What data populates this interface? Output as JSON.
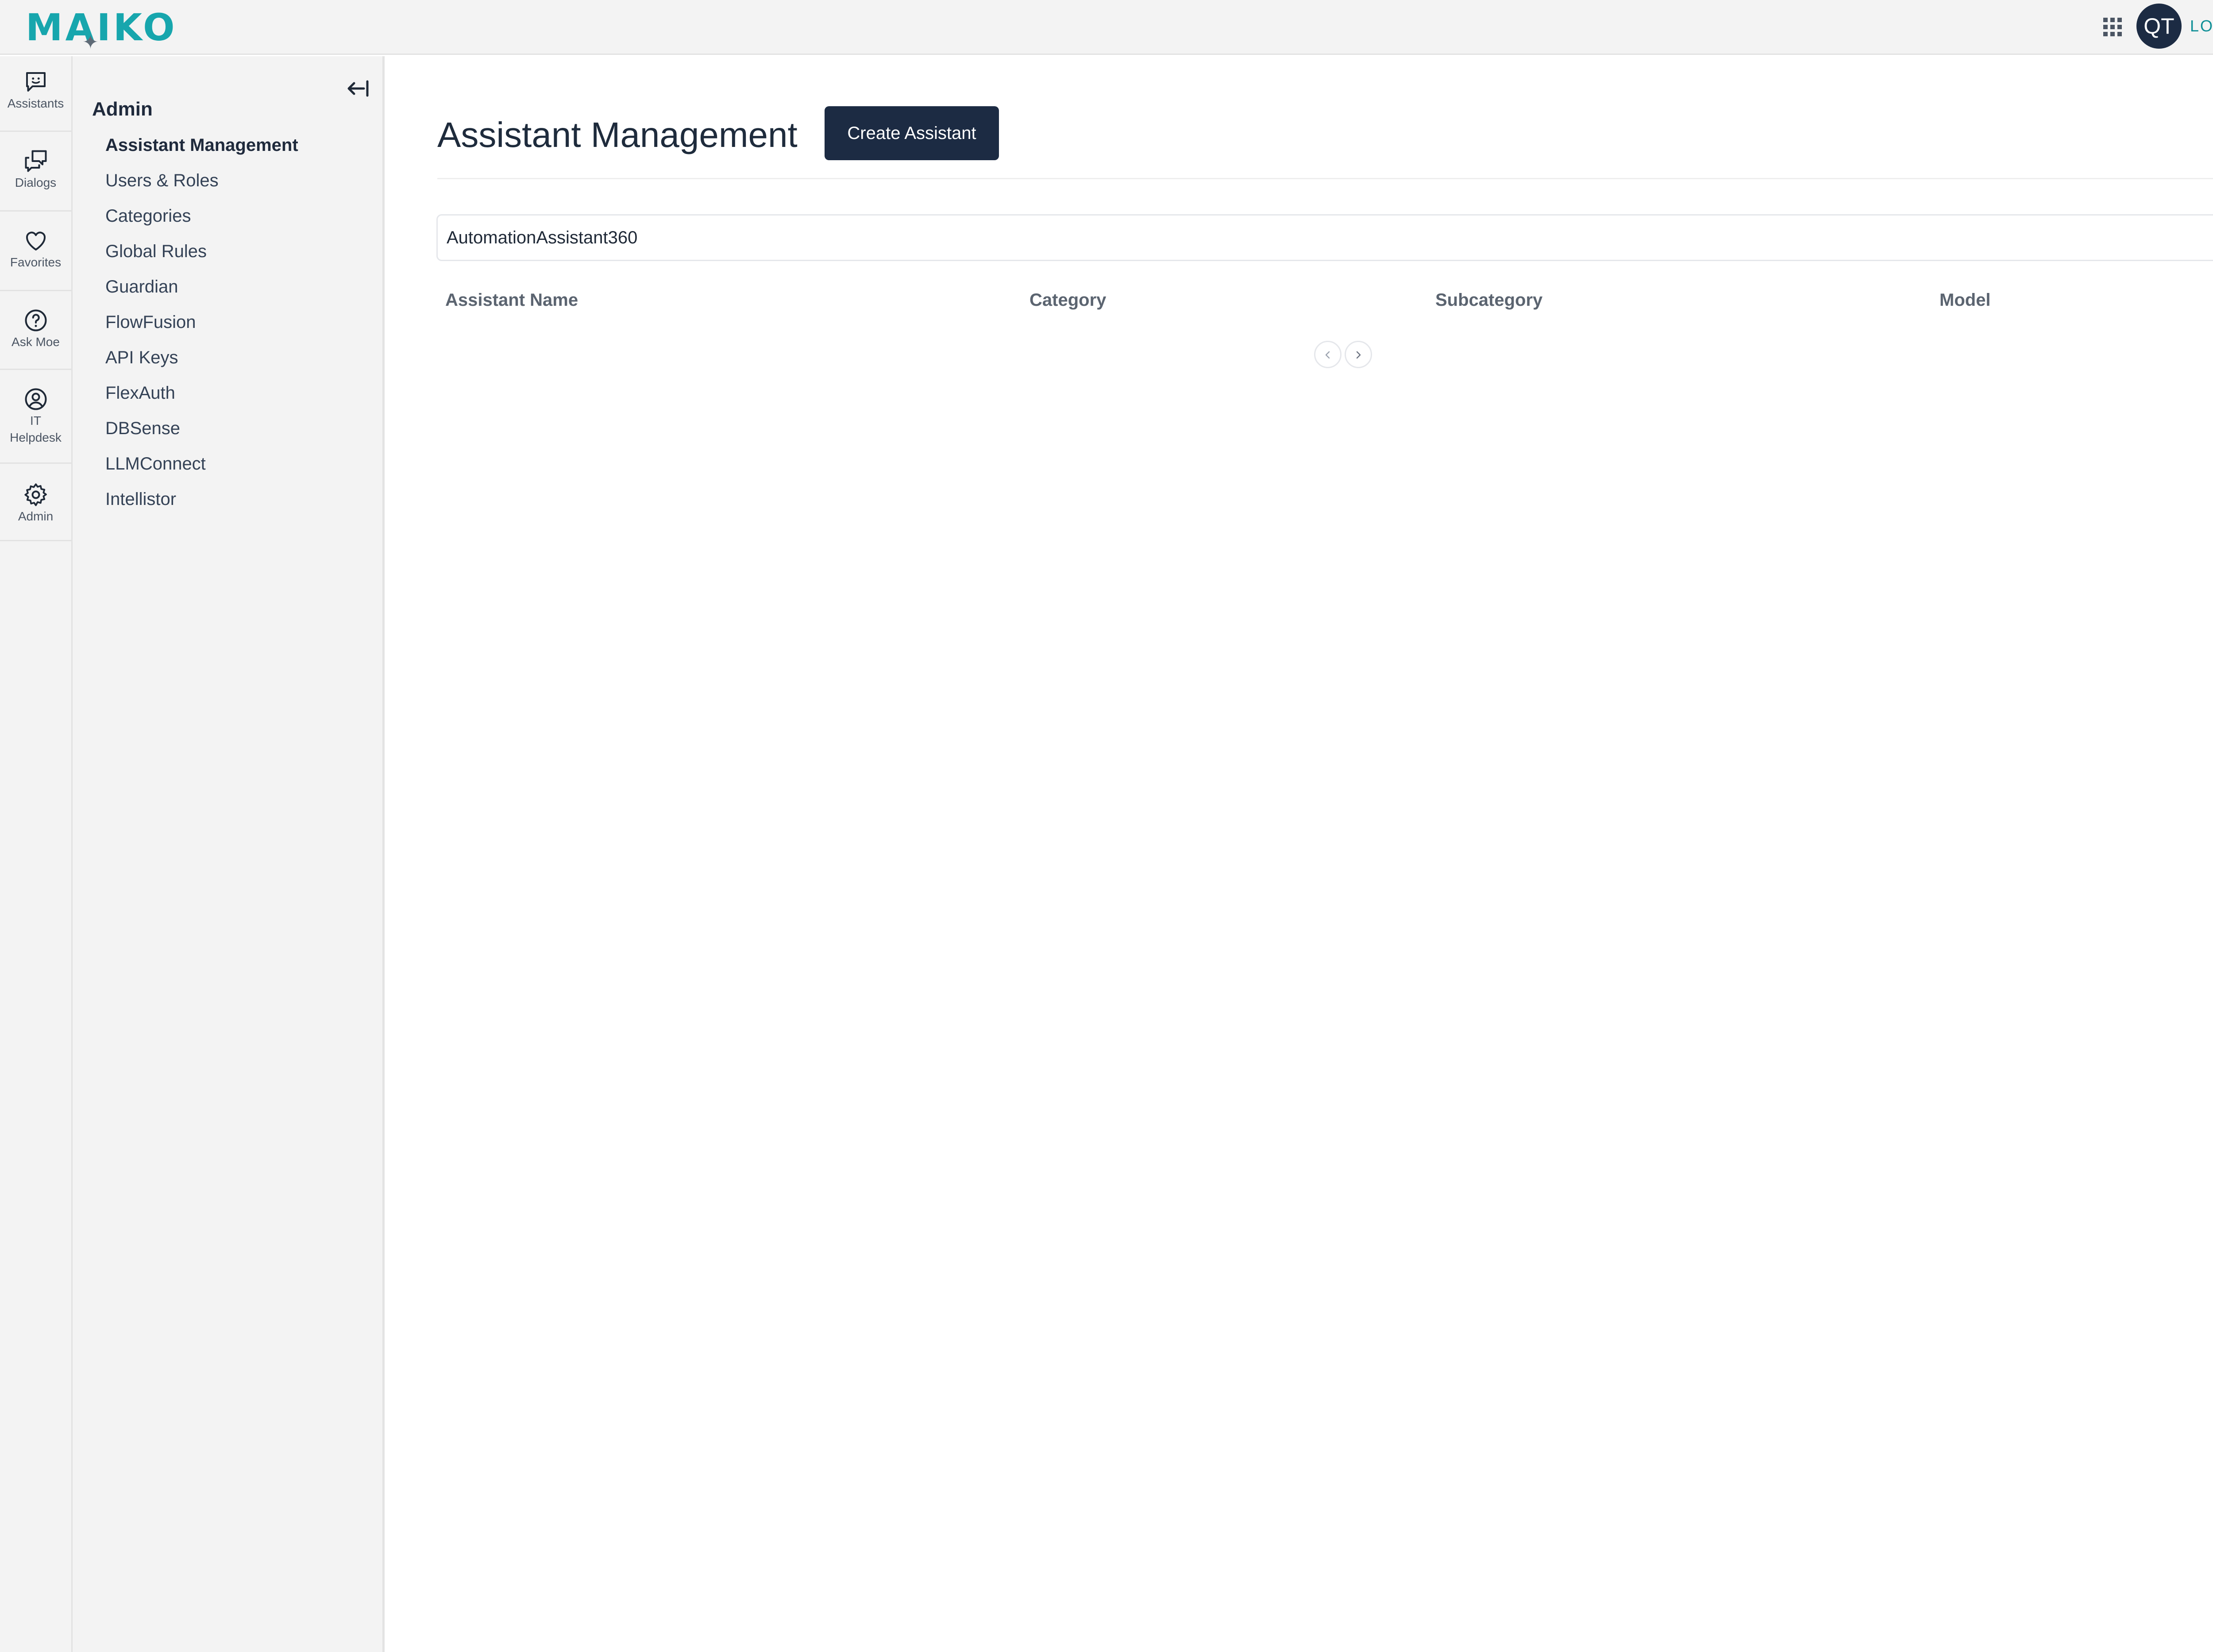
{
  "header": {
    "logo_text": "MAIKO",
    "avatar_initials": "QT",
    "logout_label": "LOGOUT",
    "apps_icon": "grid-icon"
  },
  "rail": {
    "items": [
      {
        "label": "Assistants",
        "icon": "chat-bot-icon"
      },
      {
        "label": "Dialogs",
        "icon": "dialogs-icon"
      },
      {
        "label": "Favorites",
        "icon": "heart-icon"
      },
      {
        "label": "Ask Moe",
        "icon": "question-icon"
      },
      {
        "label_line1": "IT",
        "label_line2": "Helpdesk",
        "icon": "user-circle-icon"
      },
      {
        "label": "Admin",
        "icon": "gear-icon"
      }
    ]
  },
  "nav": {
    "title": "Admin",
    "items": [
      {
        "label": "Assistant Management",
        "active": true
      },
      {
        "label": "Users & Roles"
      },
      {
        "label": "Categories"
      },
      {
        "label": "Global Rules"
      },
      {
        "label": "Guardian"
      },
      {
        "label": "FlowFusion"
      },
      {
        "label": "API Keys"
      },
      {
        "label": "FlexAuth"
      },
      {
        "label": "DBSense"
      },
      {
        "label": "LLMConnect"
      },
      {
        "label": "Intellistor"
      }
    ]
  },
  "main": {
    "title": "Assistant Management",
    "create_button_label": "Create Assistant",
    "search_value": "AutomationAssistant360",
    "columns": [
      "Assistant Name",
      "Category",
      "Subcategory",
      "Model"
    ],
    "rows": []
  },
  "colors": {
    "brand_teal": "#17a6ad",
    "navy": "#1c2b43"
  }
}
